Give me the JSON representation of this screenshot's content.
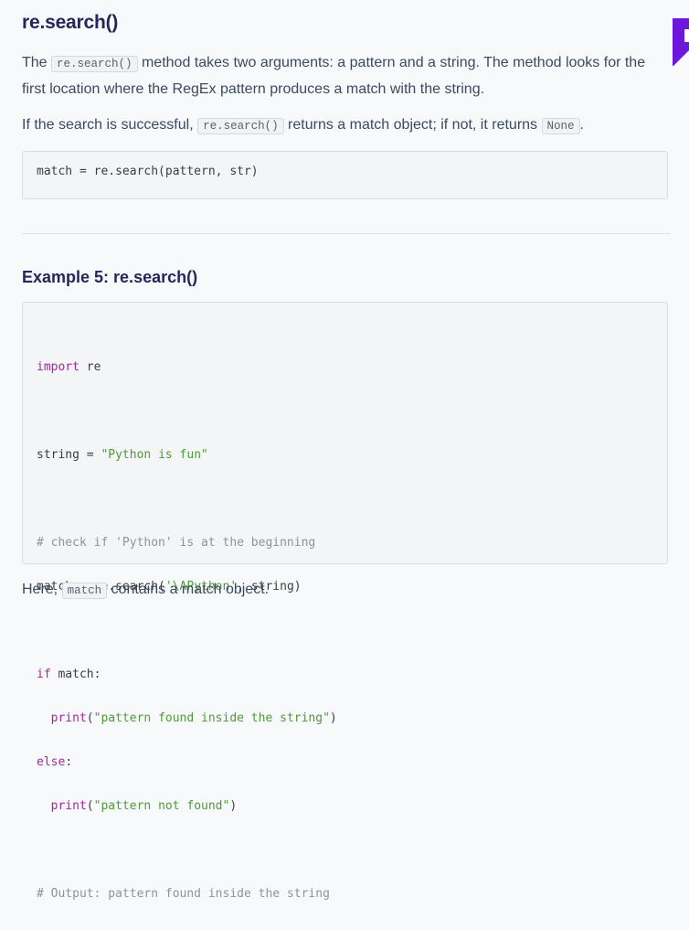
{
  "section": {
    "title": "re.search()",
    "p1_pre": "The ",
    "p1_code": "re.search()",
    "p1_post": " method takes two arguments: a pattern and a string. The method looks for the first location where the RegEx pattern produces a match with the string.",
    "p2_pre": "If the search is successful, ",
    "p2_code": "re.search()",
    "p2_mid": " returns a match object; if not, it returns ",
    "p2_code2": "None",
    "p2_post": ".",
    "syntax": "match = re.search(pattern, str)"
  },
  "example": {
    "title": "Example 5: re.search()",
    "code": {
      "l1_kw": "import",
      "l1_rest": " re",
      "l2_pre": "string = ",
      "l2_str": "\"Python is fun\"",
      "l3_cm": "# check if 'Python' is at the beginning",
      "l4_pre": "match = re.search(",
      "l4_str": "'\\APython'",
      "l4_post": ", string)",
      "l5_kw": "if",
      "l5_rest": " match:",
      "l6_kw": "  print",
      "l6_open": "(",
      "l6_str": "\"pattern found inside the string\"",
      "l6_close": ")",
      "l7_kw": "else",
      "l7_rest": ":",
      "l8_kw": "  print",
      "l8_open": "(",
      "l8_str": "\"pattern not found\"",
      "l8_close": ")",
      "l9_cm": "# Output: pattern found inside the string"
    },
    "after_pre": "Here, ",
    "after_code": "match",
    "after_post": " contains a match object."
  },
  "colors": {
    "heading": "#25265e",
    "body_text": "#3b4a60",
    "keyword": "#a626a4",
    "string": "#4f9a3a",
    "comment": "#8f9399",
    "corner_accent": "#6b18dc"
  },
  "icons": {
    "corner": "bookmark-tab-icon"
  }
}
